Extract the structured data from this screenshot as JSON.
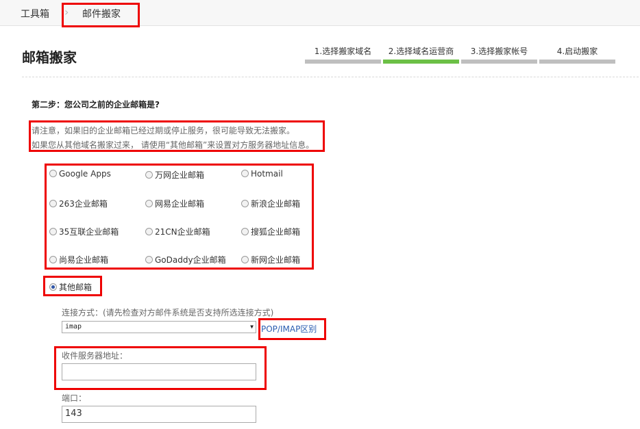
{
  "breadcrumb": {
    "root": "工具箱",
    "current": "邮件搬家"
  },
  "page_title": "邮箱搬家",
  "steps": [
    {
      "label": "1.选择搬家域名",
      "active": false
    },
    {
      "label": "2.选择域名运营商",
      "active": true
    },
    {
      "label": "3.选择搬家帐号",
      "active": false
    },
    {
      "label": "4.启动搬家",
      "active": false
    }
  ],
  "step_heading": "第二步：您公司之前的企业邮箱是?",
  "notice": {
    "line1": "请注意，如果旧的企业邮箱已经过期或停止服务，很可能导致无法搬家。",
    "line2": "如果您从其他域名搬家过来， 请使用“其他邮箱”来设置对方服务器地址信息。"
  },
  "providers": [
    "Google Apps",
    "万网企业邮箱",
    "Hotmail",
    "263企业邮箱",
    "网易企业邮箱",
    "新浪企业邮箱",
    "35互联企业邮箱",
    "21CN企业邮箱",
    "搜狐企业邮箱",
    "尚易企业邮箱",
    "GoDaddy企业邮箱",
    "新网企业邮箱"
  ],
  "other_option": {
    "label": "其他邮箱",
    "selected": true
  },
  "connection": {
    "label": "连接方式：(请先检查对方邮件系统是否支持所选连接方式)",
    "value": "imap",
    "help_link": "POP/IMAP区别"
  },
  "server": {
    "label": "收件服务器地址：",
    "value": ""
  },
  "port": {
    "label": "端口：",
    "value": "143"
  },
  "colors": {
    "accent_green": "#6cc046",
    "step_gray": "#bfbfbf",
    "link_blue": "#2a5db0",
    "highlight_red": "#e00000"
  }
}
